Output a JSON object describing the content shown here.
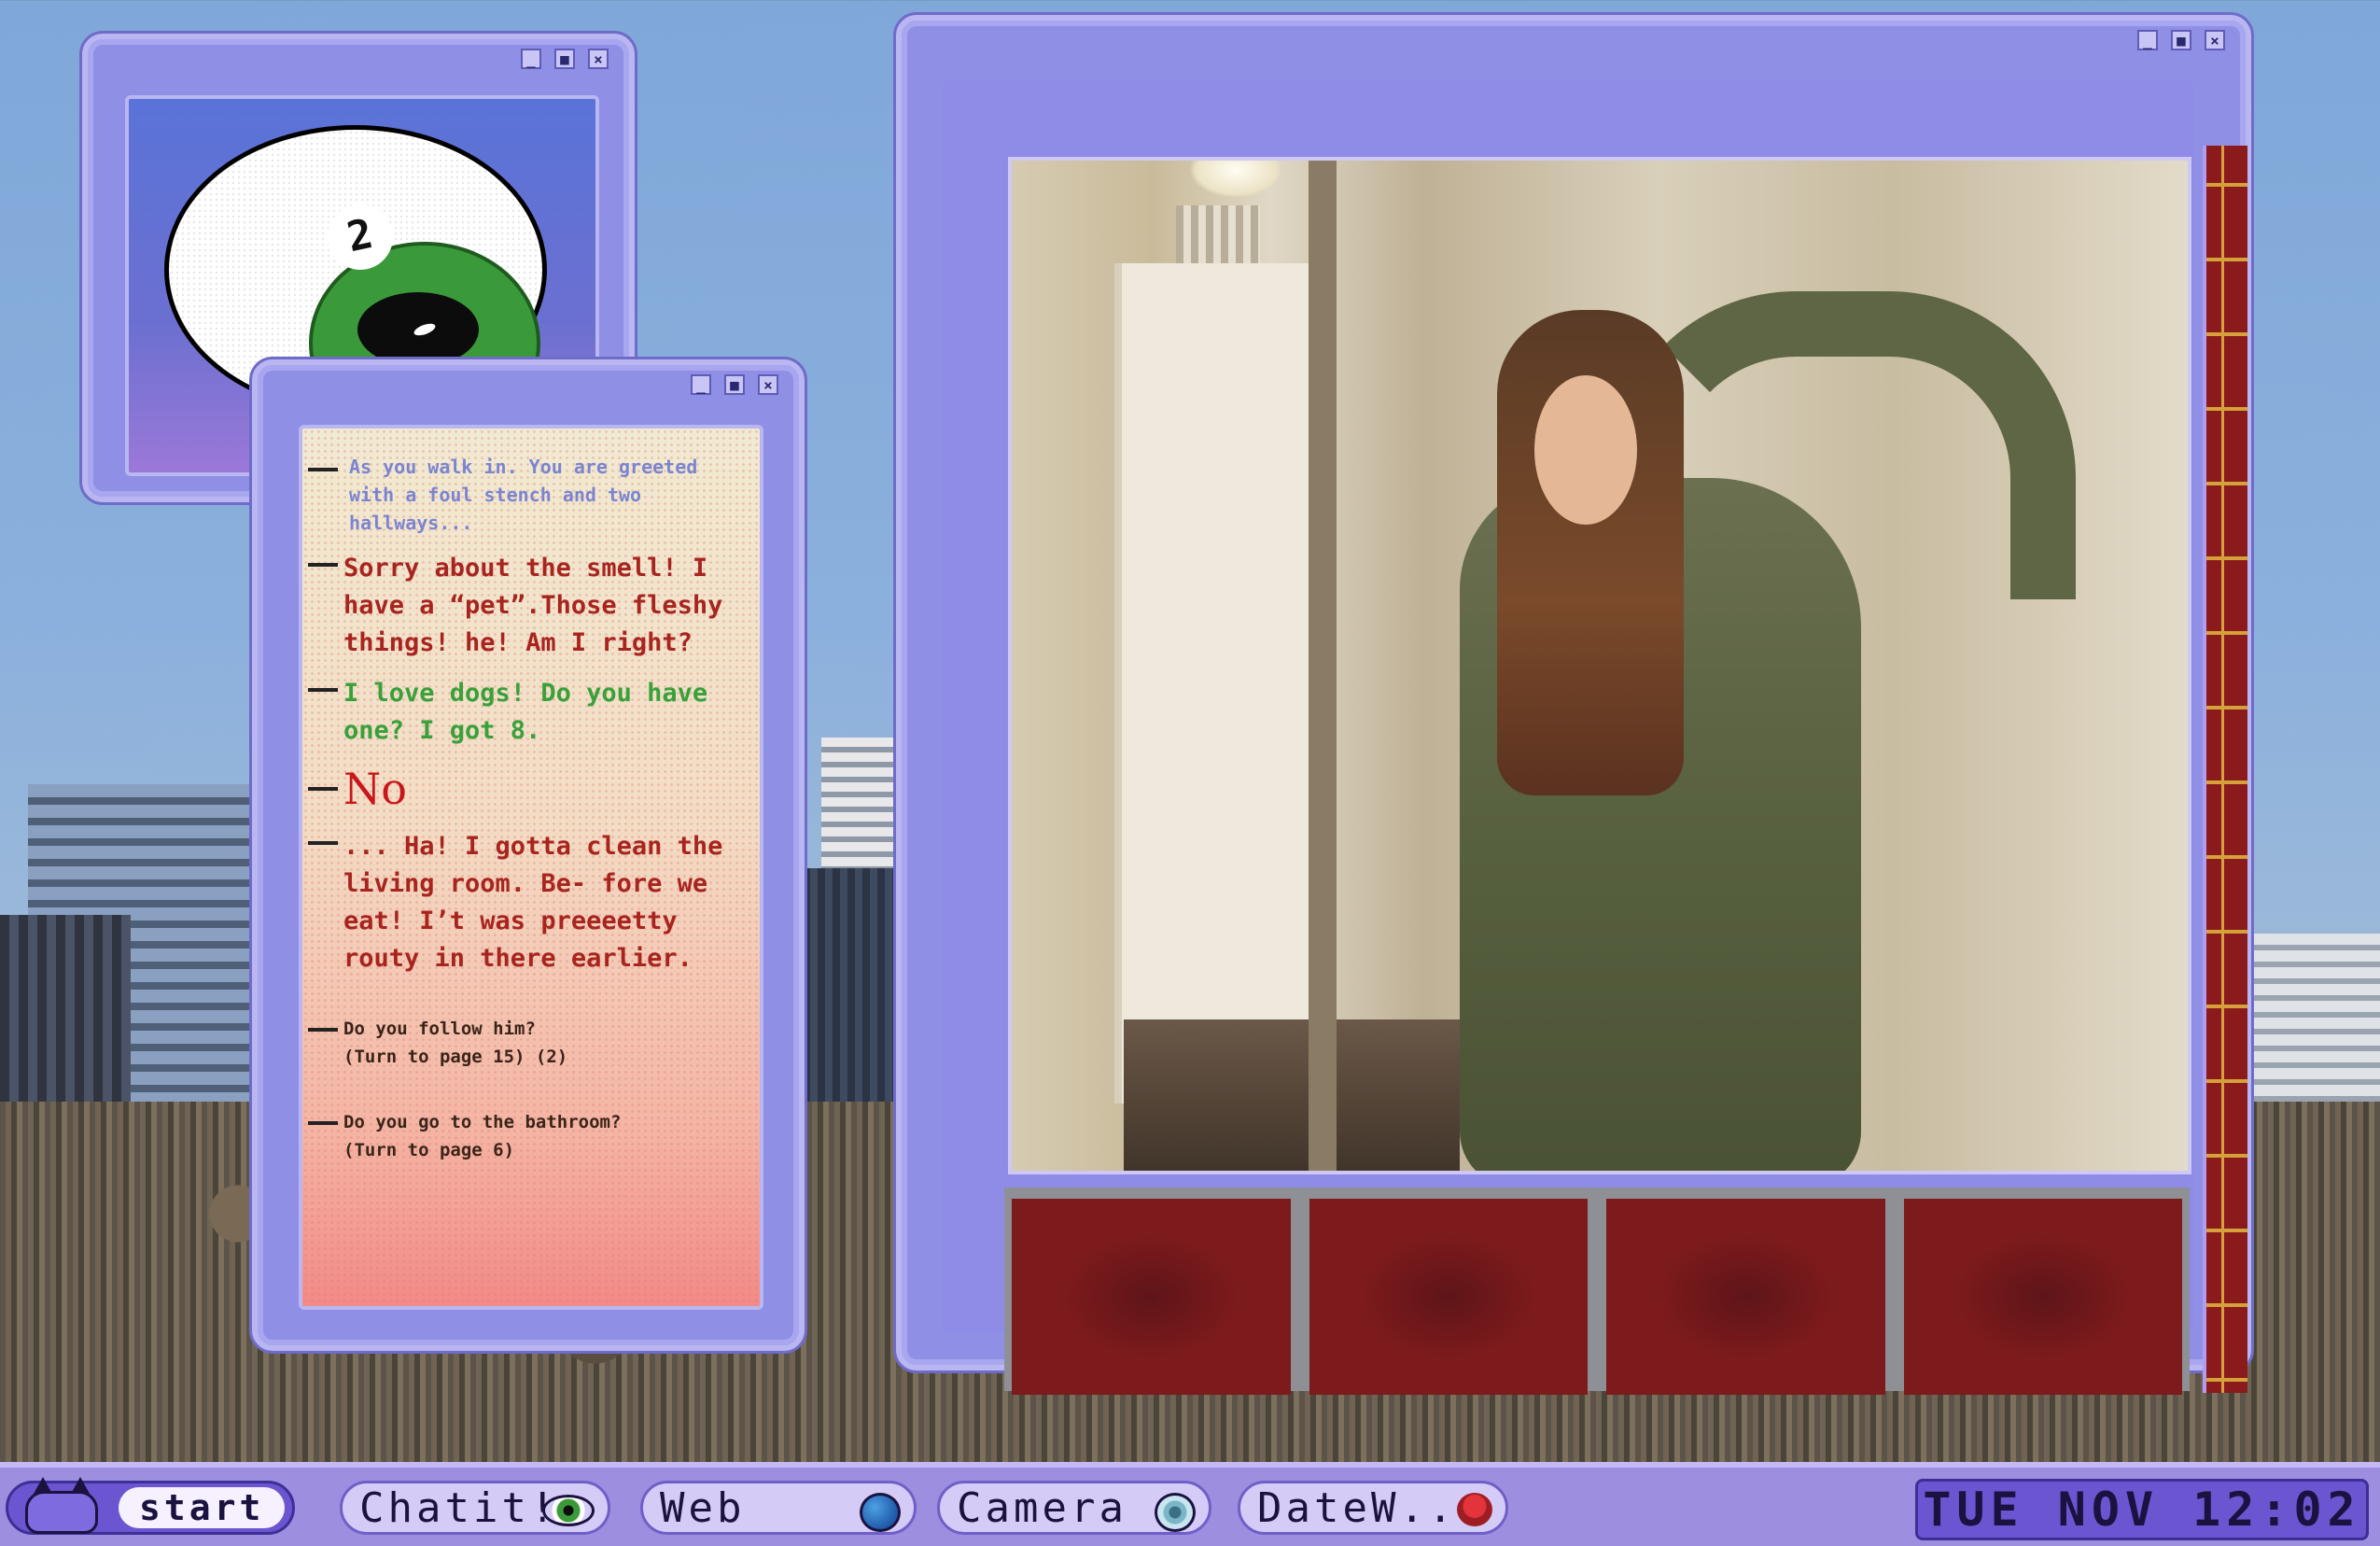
{
  "eye_window": {
    "badge_number": "2"
  },
  "chat": {
    "messages": [
      {
        "type": "narration",
        "text": "As you walk in. You are greeted with a foul stench and two hallways..."
      },
      {
        "type": "host",
        "text": "Sorry about the smell! I have a “pet”.Those fleshy things! he! Am I right?"
      },
      {
        "type": "guest",
        "text": "I love dogs! Do you have one? I got 8."
      },
      {
        "type": "no",
        "text": "No"
      },
      {
        "type": "host",
        "text": "... Ha! I gotta clean the living room. Be- fore we eat! I’t was preeeetty routy in there earlier."
      }
    ],
    "choices": [
      {
        "text": "Do you follow him?",
        "sub": "(Turn to page 15) (2)"
      },
      {
        "text": "Do you go to the bathroom?",
        "sub": "(Turn to page 6)"
      }
    ]
  },
  "camera_window": {
    "thumbnail_count": 4
  },
  "taskbar": {
    "start_label": "start",
    "chat_label": "Chatit!",
    "web_label": "Web",
    "camera_label": "Camera",
    "date_label": "DateW..",
    "clock": "TUE NOV 12:02"
  },
  "window_controls": {
    "minimize": "_",
    "maximize": "■",
    "close": "×"
  },
  "colors": {
    "window_frame": "#8f8fe6",
    "host_text": "#a8251f",
    "guest_text": "#3aa03a",
    "narration_text": "#7c84d0",
    "no_text": "#c8161a"
  }
}
